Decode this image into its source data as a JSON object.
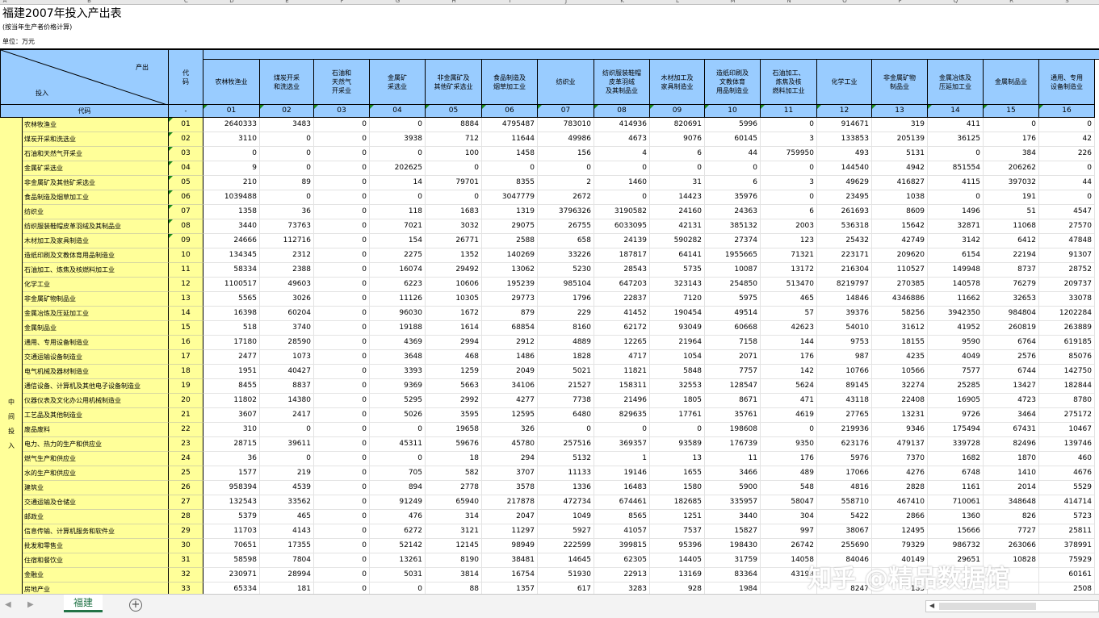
{
  "column_letters": [
    "A",
    "B",
    "C",
    "D",
    "E",
    "F",
    "G",
    "H",
    "I",
    "J",
    "K",
    "L",
    "M",
    "N",
    "O",
    "P",
    "Q",
    "R",
    "S"
  ],
  "title": "福建2007年投入产出表",
  "subtitle": "(按当年生产者价格计算)",
  "unit": "单位：万元",
  "header": {
    "output_label": "产出",
    "input_label": "投入",
    "code_header": "代\n码",
    "code_row_label": "代码",
    "code_dash": "-"
  },
  "columns": [
    {
      "name": "农林牧渔业",
      "code": "01"
    },
    {
      "name": "煤炭开采\n和洗选业",
      "code": "02"
    },
    {
      "name": "石油和\n天然气\n开采业",
      "code": "03"
    },
    {
      "name": "金属矿\n采选业",
      "code": "04"
    },
    {
      "name": "非金属矿及\n其他矿采选业",
      "code": "05"
    },
    {
      "name": "食品制造及\n烟草加工业",
      "code": "06"
    },
    {
      "name": "纺织业",
      "code": "07"
    },
    {
      "name": "纺织服装鞋帽\n皮革羽绒\n及其制品业",
      "code": "08"
    },
    {
      "name": "木材加工及\n家具制造业",
      "code": "09"
    },
    {
      "name": "造纸印刷及\n文教体育\n用品制造业",
      "code": "10"
    },
    {
      "name": "石油加工、\n炼焦及核\n燃料加工业",
      "code": "11"
    },
    {
      "name": "化学工业",
      "code": "12"
    },
    {
      "name": "非金属矿物\n制品业",
      "code": "13"
    },
    {
      "name": "金属冶炼及\n压延加工业",
      "code": "14"
    },
    {
      "name": "金属制品业",
      "code": "15"
    },
    {
      "name": "通用、专用\n设备制造业",
      "code": "16"
    }
  ],
  "group_label": [
    "中",
    "间",
    "投",
    "入"
  ],
  "rows": [
    {
      "name": "农林牧渔业",
      "code": "01",
      "values": [
        "2640333",
        "3483",
        "0",
        "0",
        "8884",
        "4795487",
        "783010",
        "414936",
        "820691",
        "5996",
        "0",
        "914671",
        "319",
        "411",
        "0",
        "0"
      ]
    },
    {
      "name": "煤炭开采和洗选业",
      "code": "02",
      "values": [
        "3110",
        "0",
        "0",
        "3938",
        "712",
        "11644",
        "49986",
        "4673",
        "9076",
        "60145",
        "3",
        "133853",
        "205139",
        "36125",
        "176",
        "42"
      ]
    },
    {
      "name": "石油和天然气开采业",
      "code": "03",
      "values": [
        "0",
        "0",
        "0",
        "0",
        "100",
        "1458",
        "156",
        "4",
        "6",
        "44",
        "759950",
        "493",
        "5131",
        "0",
        "384",
        "226"
      ]
    },
    {
      "name": "金属矿采选业",
      "code": "04",
      "values": [
        "9",
        "0",
        "0",
        "202625",
        "0",
        "0",
        "0",
        "0",
        "0",
        "0",
        "0",
        "144540",
        "4942",
        "851554",
        "206262",
        "0"
      ]
    },
    {
      "name": "非金属矿及其他矿采选业",
      "code": "05",
      "values": [
        "210",
        "89",
        "0",
        "14",
        "79701",
        "8355",
        "2",
        "1460",
        "31",
        "6",
        "3",
        "49629",
        "416827",
        "4115",
        "397032",
        "44"
      ]
    },
    {
      "name": "食品制造及烟草加工业",
      "code": "06",
      "values": [
        "1039488",
        "0",
        "0",
        "0",
        "0",
        "3047779",
        "2672",
        "0",
        "14423",
        "35976",
        "0",
        "23495",
        "1038",
        "0",
        "191",
        "0"
      ]
    },
    {
      "name": "纺织业",
      "code": "07",
      "values": [
        "1358",
        "36",
        "0",
        "118",
        "1683",
        "1319",
        "3796326",
        "3190582",
        "24160",
        "24363",
        "6",
        "261693",
        "8609",
        "1496",
        "51",
        "4547"
      ]
    },
    {
      "name": "纺织服装鞋帽皮革羽绒及其制品业",
      "code": "08",
      "values": [
        "3440",
        "73763",
        "0",
        "7021",
        "3032",
        "29075",
        "26755",
        "6033095",
        "42131",
        "385132",
        "2003",
        "536318",
        "15642",
        "32871",
        "11068",
        "27570"
      ]
    },
    {
      "name": "木材加工及家具制造业",
      "code": "09",
      "values": [
        "24666",
        "112716",
        "0",
        "154",
        "26771",
        "2588",
        "658",
        "24139",
        "590282",
        "27374",
        "123",
        "25432",
        "42749",
        "3142",
        "6412",
        "47848"
      ]
    },
    {
      "name": "造纸印刷及文教体育用品制造业",
      "code": "10",
      "values": [
        "134345",
        "2312",
        "0",
        "2275",
        "1352",
        "140269",
        "33226",
        "187817",
        "64141",
        "1955665",
        "71321",
        "223171",
        "209620",
        "6154",
        "22194",
        "91307"
      ]
    },
    {
      "name": "石油加工、炼焦及核燃料加工业",
      "code": "11",
      "values": [
        "58334",
        "2388",
        "0",
        "16074",
        "29492",
        "13062",
        "5230",
        "28543",
        "5735",
        "10087",
        "13172",
        "216304",
        "110527",
        "149948",
        "8737",
        "28752"
      ]
    },
    {
      "name": "化学工业",
      "code": "12",
      "values": [
        "1100517",
        "49603",
        "0",
        "6223",
        "10606",
        "195239",
        "985104",
        "647203",
        "323143",
        "254850",
        "513470",
        "8219797",
        "270385",
        "140578",
        "76279",
        "209737"
      ]
    },
    {
      "name": "非金属矿物制品业",
      "code": "13",
      "values": [
        "5565",
        "3026",
        "0",
        "11126",
        "10305",
        "29773",
        "1796",
        "22837",
        "7120",
        "5975",
        "465",
        "14846",
        "4346886",
        "11662",
        "32653",
        "33078"
      ]
    },
    {
      "name": "金属冶炼及压延加工业",
      "code": "14",
      "values": [
        "16398",
        "60204",
        "0",
        "96030",
        "1672",
        "879",
        "229",
        "41452",
        "190454",
        "49514",
        "57",
        "39376",
        "58256",
        "3942350",
        "984804",
        "1202284"
      ]
    },
    {
      "name": "金属制品业",
      "code": "15",
      "values": [
        "518",
        "3740",
        "0",
        "19188",
        "1614",
        "68854",
        "8160",
        "62172",
        "93049",
        "60668",
        "42623",
        "54010",
        "31612",
        "41952",
        "260819",
        "263889"
      ]
    },
    {
      "name": "通用、专用设备制造业",
      "code": "16",
      "values": [
        "17180",
        "28590",
        "0",
        "4369",
        "2994",
        "2912",
        "4889",
        "12265",
        "21964",
        "7158",
        "144",
        "9753",
        "18155",
        "9590",
        "6764",
        "619185"
      ]
    },
    {
      "name": "交通运输设备制造业",
      "code": "17",
      "values": [
        "2477",
        "1073",
        "0",
        "3648",
        "468",
        "1486",
        "1828",
        "4717",
        "1054",
        "2071",
        "176",
        "987",
        "4235",
        "4049",
        "2576",
        "85076"
      ]
    },
    {
      "name": "电气机械及器材制造业",
      "code": "18",
      "values": [
        "1951",
        "40427",
        "0",
        "3393",
        "1259",
        "2049",
        "5021",
        "11821",
        "5848",
        "7757",
        "142",
        "10766",
        "10566",
        "7577",
        "6744",
        "142750"
      ]
    },
    {
      "name": "通信设备、计算机及其他电子设备制造业",
      "code": "19",
      "values": [
        "8455",
        "8837",
        "0",
        "9369",
        "5663",
        "34106",
        "21527",
        "158311",
        "32553",
        "128547",
        "5624",
        "89145",
        "32274",
        "25285",
        "13427",
        "182844"
      ]
    },
    {
      "name": "仪器仪表及文化办公用机械制造业",
      "code": "20",
      "values": [
        "11802",
        "14380",
        "0",
        "5295",
        "2992",
        "4277",
        "7738",
        "21496",
        "1805",
        "8671",
        "471",
        "43118",
        "22408",
        "16905",
        "4723",
        "8780"
      ]
    },
    {
      "name": "工艺品及其他制造业",
      "code": "21",
      "values": [
        "3607",
        "2417",
        "0",
        "5026",
        "3595",
        "12595",
        "6480",
        "829635",
        "17761",
        "35761",
        "4619",
        "27765",
        "13231",
        "9726",
        "3464",
        "275172"
      ]
    },
    {
      "name": "废品废料",
      "code": "22",
      "values": [
        "310",
        "0",
        "0",
        "0",
        "19658",
        "326",
        "0",
        "0",
        "0",
        "198608",
        "0",
        "219936",
        "9346",
        "175494",
        "67431",
        "10467"
      ]
    },
    {
      "name": "电力、热力的生产和供应业",
      "code": "23",
      "values": [
        "28715",
        "39611",
        "0",
        "45311",
        "59676",
        "45780",
        "257516",
        "369357",
        "93589",
        "176739",
        "9350",
        "623176",
        "479137",
        "339728",
        "82496",
        "139746"
      ]
    },
    {
      "name": "燃气生产和供应业",
      "code": "24",
      "values": [
        "36",
        "0",
        "0",
        "0",
        "18",
        "294",
        "5132",
        "1",
        "13",
        "11",
        "176",
        "5976",
        "7370",
        "1682",
        "1870",
        "460"
      ]
    },
    {
      "name": "水的生产和供应业",
      "code": "25",
      "values": [
        "1577",
        "219",
        "0",
        "705",
        "582",
        "3707",
        "11133",
        "19146",
        "1655",
        "3466",
        "489",
        "17066",
        "4276",
        "6748",
        "1410",
        "4676"
      ]
    },
    {
      "name": "建筑业",
      "code": "26",
      "values": [
        "958394",
        "4539",
        "0",
        "894",
        "2778",
        "3578",
        "1336",
        "16483",
        "1580",
        "5900",
        "548",
        "4816",
        "2828",
        "1161",
        "2014",
        "5529"
      ]
    },
    {
      "name": "交通运输及仓储业",
      "code": "27",
      "values": [
        "132543",
        "33562",
        "0",
        "91249",
        "65940",
        "217878",
        "472734",
        "674461",
        "182685",
        "335957",
        "58047",
        "558710",
        "467410",
        "710061",
        "348648",
        "414714"
      ]
    },
    {
      "name": "邮政业",
      "code": "28",
      "values": [
        "5379",
        "465",
        "0",
        "476",
        "314",
        "2047",
        "1049",
        "8565",
        "1251",
        "3440",
        "304",
        "5422",
        "2866",
        "1360",
        "826",
        "5723"
      ]
    },
    {
      "name": "信息传输、计算机服务和软件业",
      "code": "29",
      "values": [
        "11703",
        "4143",
        "0",
        "6272",
        "3121",
        "11297",
        "5927",
        "41057",
        "7537",
        "15827",
        "997",
        "38067",
        "12495",
        "15666",
        "7727",
        "25811"
      ]
    },
    {
      "name": "批发和零售业",
      "code": "30",
      "values": [
        "70651",
        "17355",
        "0",
        "52142",
        "12145",
        "98949",
        "222599",
        "399815",
        "95396",
        "198430",
        "26742",
        "255690",
        "79329",
        "986732",
        "263066",
        "378991"
      ]
    },
    {
      "name": "住宿和餐饮业",
      "code": "31",
      "values": [
        "58598",
        "7804",
        "0",
        "13261",
        "8190",
        "38481",
        "14645",
        "62305",
        "14405",
        "31759",
        "14058",
        "84046",
        "40149",
        "29651",
        "10828",
        "75929"
      ]
    },
    {
      "name": "金融业",
      "code": "32",
      "values": [
        "230971",
        "28994",
        "0",
        "5031",
        "3814",
        "16754",
        "51930",
        "22913",
        "13169",
        "83364",
        "43198",
        "",
        "",
        "",
        "",
        "60161"
      ]
    },
    {
      "name": "房地产业",
      "code": "33",
      "values": [
        "65334",
        "181",
        "0",
        "0",
        "88",
        "1357",
        "617",
        "3283",
        "928",
        "1984",
        "",
        "8247",
        "183",
        "",
        "",
        "2508"
      ]
    }
  ],
  "tabs": {
    "active": "福建",
    "add_symbol": "+",
    "prev": "◀",
    "next": "▶"
  },
  "watermark": "知乎 @精品数据馆"
}
